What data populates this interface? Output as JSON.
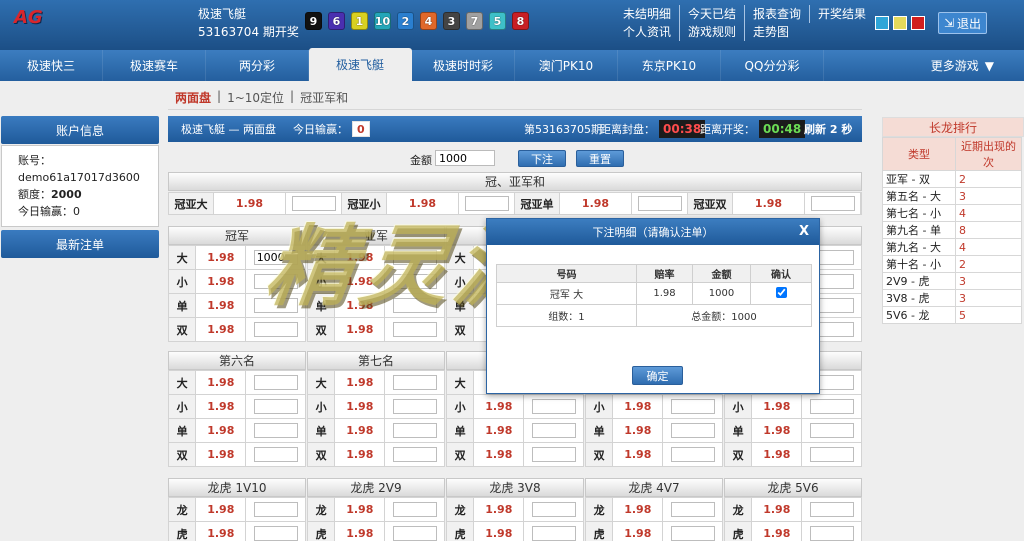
{
  "header": {
    "logo_text": "AG",
    "game_name": "极速飞艇",
    "period_text": "53163704 期开奖",
    "draw_numbers": [
      {
        "n": "9",
        "color": "#111111"
      },
      {
        "n": "6",
        "color": "#4a2fb0"
      },
      {
        "n": "1",
        "color": "#d8d020"
      },
      {
        "n": "10",
        "color": "#24a6b8"
      },
      {
        "n": "2",
        "color": "#2a7fd0"
      },
      {
        "n": "4",
        "color": "#e0682a"
      },
      {
        "n": "3",
        "color": "#444444"
      },
      {
        "n": "7",
        "color": "#a0a0a0"
      },
      {
        "n": "5",
        "color": "#3ec0c8"
      },
      {
        "n": "8",
        "color": "#c81f25"
      }
    ],
    "links_row1": [
      "未结明细",
      "今天已结",
      "报表查询",
      "开奖结果"
    ],
    "links_row2": [
      "个人资讯",
      "游戏规则",
      "走势图"
    ],
    "swatch_colors": [
      "#2ea5d8",
      "#e4d95c",
      "#d11d1d"
    ],
    "logout_label": "退出"
  },
  "nav": {
    "tabs": [
      "极速快三",
      "极速赛车",
      "两分彩",
      "极速飞艇",
      "极速时时彩",
      "澳门PK10",
      "东京PK10",
      "QQ分分彩"
    ],
    "active_index": 3,
    "more_label": "更多游戏"
  },
  "subnav": {
    "items": [
      "两面盘",
      "1~10定位",
      "冠亚军和"
    ],
    "sep": "|"
  },
  "sidebar": {
    "account_title": "账户信息",
    "account_label": "账号：",
    "account_value": "demo61a17017d3600",
    "quota_label": "额度：",
    "quota_value": "2000",
    "winloss_label": "今日输赢：",
    "winloss_value": "0",
    "latest_bets_title": "最新注单"
  },
  "status": {
    "title": "极速飞艇 — 两面盘",
    "today_label": "今日输赢：",
    "today_value": "0",
    "period": "第53163705期",
    "close_label": "距离封盘：",
    "close_timer": "00:38",
    "draw_label": "距离开奖：",
    "draw_timer": "00:48",
    "refresh": "刷新 2 秒"
  },
  "betbar": {
    "amount_label": "金额",
    "amount_value": "1000",
    "submit_label": "下注",
    "reset_label": "重置"
  },
  "champion_sum": {
    "title": "冠、亚军和",
    "cells": [
      {
        "name": "冠亚大",
        "odds": "1.98"
      },
      {
        "name": "冠亚小",
        "odds": "1.98"
      },
      {
        "name": "冠亚单",
        "odds": "1.98"
      },
      {
        "name": "冠亚双",
        "odds": "1.98"
      }
    ]
  },
  "blocks_row1": [
    {
      "title": "冠军",
      "rows": [
        {
          "name": "大",
          "odds": "1.98",
          "value": "1000"
        },
        {
          "name": "小",
          "odds": "1.98",
          "value": ""
        },
        {
          "name": "单",
          "odds": "1.98",
          "value": ""
        },
        {
          "name": "双",
          "odds": "1.98",
          "value": ""
        }
      ]
    },
    {
      "title": "亚军",
      "rows": [
        {
          "name": "大",
          "odds": "1.98",
          "value": ""
        },
        {
          "name": "小",
          "odds": "1.98",
          "value": ""
        },
        {
          "name": "单",
          "odds": "1.98",
          "value": ""
        },
        {
          "name": "双",
          "odds": "1.98",
          "value": ""
        }
      ]
    },
    {
      "title": "",
      "rows": [
        {
          "name": "大",
          "odds": "",
          "value": ""
        },
        {
          "name": "小",
          "odds": "",
          "value": ""
        },
        {
          "name": "单",
          "odds": "",
          "value": ""
        },
        {
          "name": "双",
          "odds": "",
          "value": ""
        }
      ]
    },
    {
      "title": "",
      "rows": [
        {
          "name": "",
          "odds": "",
          "value": ""
        },
        {
          "name": "",
          "odds": "",
          "value": ""
        },
        {
          "name": "",
          "odds": "",
          "value": ""
        },
        {
          "name": "",
          "odds": "",
          "value": ""
        }
      ]
    },
    {
      "title": "",
      "rows": [
        {
          "name": "",
          "odds": "",
          "value": ""
        },
        {
          "name": "",
          "odds": "",
          "value": ""
        },
        {
          "name": "",
          "odds": "",
          "value": ""
        },
        {
          "name": "",
          "odds": "",
          "value": ""
        }
      ]
    }
  ],
  "blocks_row2": [
    {
      "title": "第六名",
      "rows": [
        {
          "name": "大",
          "odds": "1.98"
        },
        {
          "name": "小",
          "odds": "1.98"
        },
        {
          "name": "单",
          "odds": "1.98"
        },
        {
          "name": "双",
          "odds": "1.98"
        }
      ]
    },
    {
      "title": "第七名",
      "rows": [
        {
          "name": "大",
          "odds": "1.98"
        },
        {
          "name": "小",
          "odds": "1.98"
        },
        {
          "name": "单",
          "odds": "1.98"
        },
        {
          "name": "双",
          "odds": "1.98"
        }
      ]
    },
    {
      "title": "",
      "rows": [
        {
          "name": "大",
          "odds": "1.98"
        },
        {
          "name": "小",
          "odds": "1.98"
        },
        {
          "name": "单",
          "odds": "1.98"
        },
        {
          "name": "双",
          "odds": "1.98"
        }
      ]
    },
    {
      "title": "",
      "rows": [
        {
          "name": "大",
          "odds": "1.98"
        },
        {
          "name": "小",
          "odds": "1.98"
        },
        {
          "name": "单",
          "odds": "1.98"
        },
        {
          "name": "双",
          "odds": "1.98"
        }
      ]
    },
    {
      "title": "",
      "rows": [
        {
          "name": "大",
          "odds": "1.98"
        },
        {
          "name": "小",
          "odds": "1.98"
        },
        {
          "name": "单",
          "odds": "1.98"
        },
        {
          "name": "双",
          "odds": "1.98"
        }
      ]
    }
  ],
  "blocks_row3": [
    {
      "title": "龙虎 1V10",
      "rows": [
        {
          "name": "龙",
          "odds": "1.98"
        },
        {
          "name": "虎",
          "odds": "1.98"
        }
      ]
    },
    {
      "title": "龙虎 2V9",
      "rows": [
        {
          "name": "龙",
          "odds": "1.98"
        },
        {
          "name": "虎",
          "odds": "1.98"
        }
      ]
    },
    {
      "title": "龙虎 3V8",
      "rows": [
        {
          "name": "龙",
          "odds": "1.98"
        },
        {
          "name": "虎",
          "odds": "1.98"
        }
      ]
    },
    {
      "title": "龙虎 4V7",
      "rows": [
        {
          "name": "龙",
          "odds": "1.98"
        },
        {
          "name": "虎",
          "odds": "1.98"
        }
      ]
    },
    {
      "title": "龙虎 5V6",
      "rows": [
        {
          "name": "龙",
          "odds": "1.98"
        },
        {
          "name": "虎",
          "odds": "1.98"
        }
      ]
    }
  ],
  "longdragon": {
    "title": "长龙排行",
    "col_type": "类型",
    "col_count": "近期出现的次",
    "rows": [
      {
        "type": "亚军 - 双",
        "count": "2"
      },
      {
        "type": "第五名 - 大",
        "count": "3"
      },
      {
        "type": "第七名 - 小",
        "count": "4"
      },
      {
        "type": "第九名 - 单",
        "count": "8"
      },
      {
        "type": "第九名 - 大",
        "count": "4"
      },
      {
        "type": "第十名 - 小",
        "count": "2"
      },
      {
        "type": "2V9 - 虎",
        "count": "3"
      },
      {
        "type": "3V8 - 虎",
        "count": "3"
      },
      {
        "type": "5V6 - 龙",
        "count": "5"
      }
    ]
  },
  "modal": {
    "title": "下注明细（请确认注单）",
    "close_label": "X",
    "col_code": "号码",
    "col_odds": "赔率",
    "col_amount": "金额",
    "col_confirm": "确认",
    "item_code": "冠军 大",
    "item_odds": "1.98",
    "item_amount": "1000",
    "group_count": "组数：1",
    "total": "总金额：1000",
    "ok_label": "确定"
  },
  "watermark": "精灵源码"
}
